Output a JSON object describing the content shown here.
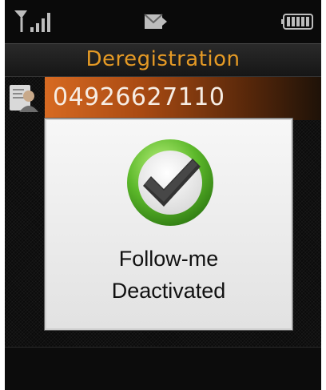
{
  "status_bar": {
    "signal_icon": "signal-strength-icon",
    "message_icon": "message-envelope-icon",
    "battery_icon": "battery-icon"
  },
  "header": {
    "title": "Deregistration",
    "title_color": "#e59a25"
  },
  "list": {
    "items": [
      {
        "icon": "contact-icon",
        "label": "04926627110"
      }
    ],
    "selected_color": "#d76a22"
  },
  "dialog": {
    "icon": "checkmark-icon",
    "line1": "Follow-me",
    "line2": "Deactivated"
  }
}
